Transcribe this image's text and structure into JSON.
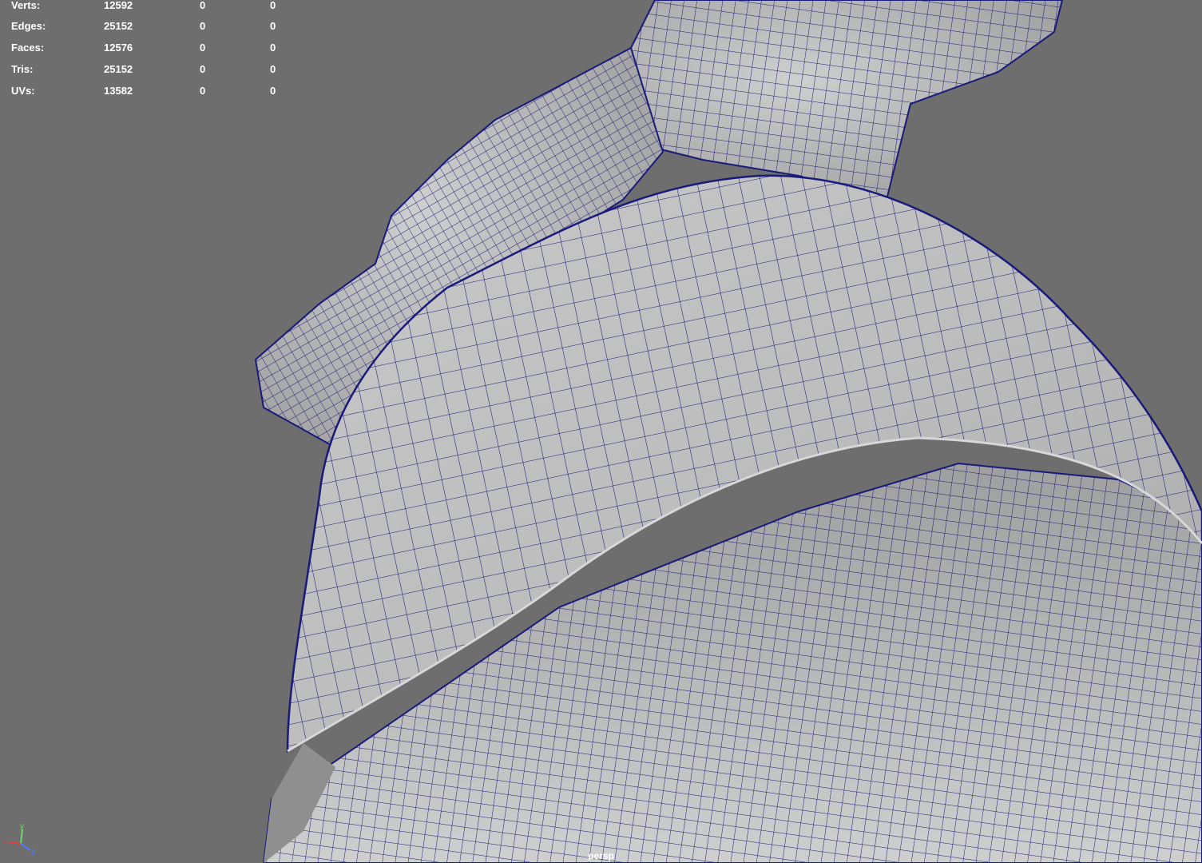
{
  "hud": {
    "rows": [
      {
        "label": "Verts:",
        "total": "12592",
        "selected": "0",
        "component": "0"
      },
      {
        "label": "Edges:",
        "total": "25152",
        "selected": "0",
        "component": "0"
      },
      {
        "label": "Faces:",
        "total": "12576",
        "selected": "0",
        "component": "0"
      },
      {
        "label": "Tris:",
        "total": "25152",
        "selected": "0",
        "component": "0"
      },
      {
        "label": "UVs:",
        "total": "13582",
        "selected": "0",
        "component": "0"
      }
    ]
  },
  "camera": {
    "name": "persp"
  },
  "gizmo": {
    "x_label": "x",
    "y_label": "y",
    "z_label": "z",
    "x_color": "#e0403a",
    "y_color": "#6fd66f",
    "z_color": "#4d7dff"
  },
  "colors": {
    "background": "#6e6e6e",
    "wire": "#1a1a7a",
    "surface": "#b9b9b9"
  }
}
